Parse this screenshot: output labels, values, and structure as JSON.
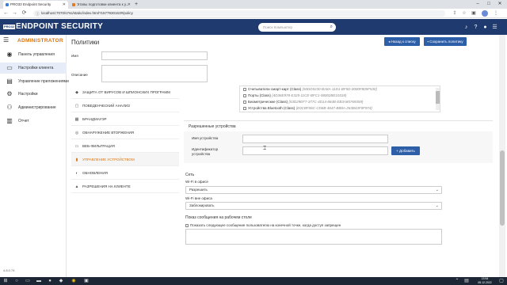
{
  "browser": {
    "tabs": [
      {
        "title": "PRO32 Endpoint Security",
        "active": true
      },
      {
        "title": "Этапы подготовки клиента к у...",
        "active": false
      }
    ],
    "new_tab": "+",
    "url": "localhost:7070/s7ss/static/index.html?1577930163#/policy",
    "nav": {
      "back": "←",
      "forward": "→",
      "reload": "⟳"
    },
    "window_controls": {
      "minimize": "–",
      "maximize": "□",
      "close": "✕"
    }
  },
  "app": {
    "logo_badge": "PRO32",
    "title": "ENDPOINT SECURITY",
    "search_placeholder": "Поиск Компьютер",
    "header_icons": [
      "bell-icon",
      "help-icon",
      "user-icon",
      "menu-icon"
    ]
  },
  "sidebar": {
    "role": "ADMINISTRATOR",
    "items": [
      {
        "label": "Панель управления",
        "icon": "dashboard-icon",
        "active": false
      },
      {
        "label": "Настройки клиента",
        "icon": "monitor-icon",
        "active": true
      },
      {
        "label": "Управление приложениями",
        "icon": "apps-icon",
        "active": false
      },
      {
        "label": "Настройки",
        "icon": "gear-icon",
        "active": false
      },
      {
        "label": "Администрирование",
        "icon": "admin-icon",
        "active": false
      },
      {
        "label": "Отчет",
        "icon": "report-icon",
        "active": false
      }
    ],
    "version": "4.8.0.74"
  },
  "main": {
    "page_title": "Политики",
    "back_button": "Назад к списку",
    "save_button": "Сохранить политику",
    "name_label": "Имя",
    "name_value": "",
    "description_label": "Описание",
    "description_value": "",
    "sections": [
      {
        "label": "ЗАЩИТА ОТ ВИРУСОВ И ШПИОНСКИХ ПРОГРАММ",
        "active": false
      },
      {
        "label": "ПОВЕДЕНЧЕСКИЙ АНАЛИЗ",
        "active": false
      },
      {
        "label": "БРАНДМАУЭР",
        "active": false
      },
      {
        "label": "ОБНАРУЖЕНИЕ ВТОРЖЕНИЯ",
        "active": false
      },
      {
        "label": "ВЕБ-ФИЛЬТРАЦИЯ",
        "active": false
      },
      {
        "label": "УПРАВЛЕНИЕ УСТРОЙСТВОМ",
        "active": true
      },
      {
        "label": "ОБНОВЛЕНИЯ",
        "active": false
      },
      {
        "label": "РАЗРЕШЕНИЯ НА КЛИЕНТЕ",
        "active": false
      }
    ],
    "device_classes": [
      {
        "label": "Считыватели смарт-карт (Class)",
        "guid": "{50DD5230-BA8A-11D1-BF5D-0000F805F530}"
      },
      {
        "label": "Порты (Class)",
        "guid": "{4D36E978-E325-11CE-BFC1-08002BE10318}"
      },
      {
        "label": "Биометрические (Class)",
        "guid": "{53D29EF7-377C-4D14-864B-EB3A85769359}"
      },
      {
        "label": "Устройства Bluetooth (Class)",
        "guid": "{E0CBF06C-CD8B-4647-BB8A-263B43F0F974}"
      }
    ],
    "allowed_devices": {
      "heading": "Разрешенные устройства",
      "device_name_label": "Имя устройства",
      "device_id_label": "Идентификатор устройства",
      "add_button": "+ Добавить"
    },
    "network": {
      "heading": "Сеть",
      "wifi_office_label": "Wi-Fi в офисе",
      "wifi_office_value": "Разрешить",
      "wifi_outside_label": "Wi-Fi вне офиса",
      "wifi_outside_value": "Заблокировать"
    },
    "message": {
      "heading": "Показ сообщения на рабочем столе",
      "checkbox_label": "Показать следующее сообщение пользователю на конечной точке, когда доступ запрещен"
    }
  },
  "taskbar": {
    "time": "13:54",
    "date": "08.12.2022"
  },
  "colors": {
    "header": "#1e3a6e",
    "accent": "#d9730d",
    "button": "#2d5ea8"
  }
}
